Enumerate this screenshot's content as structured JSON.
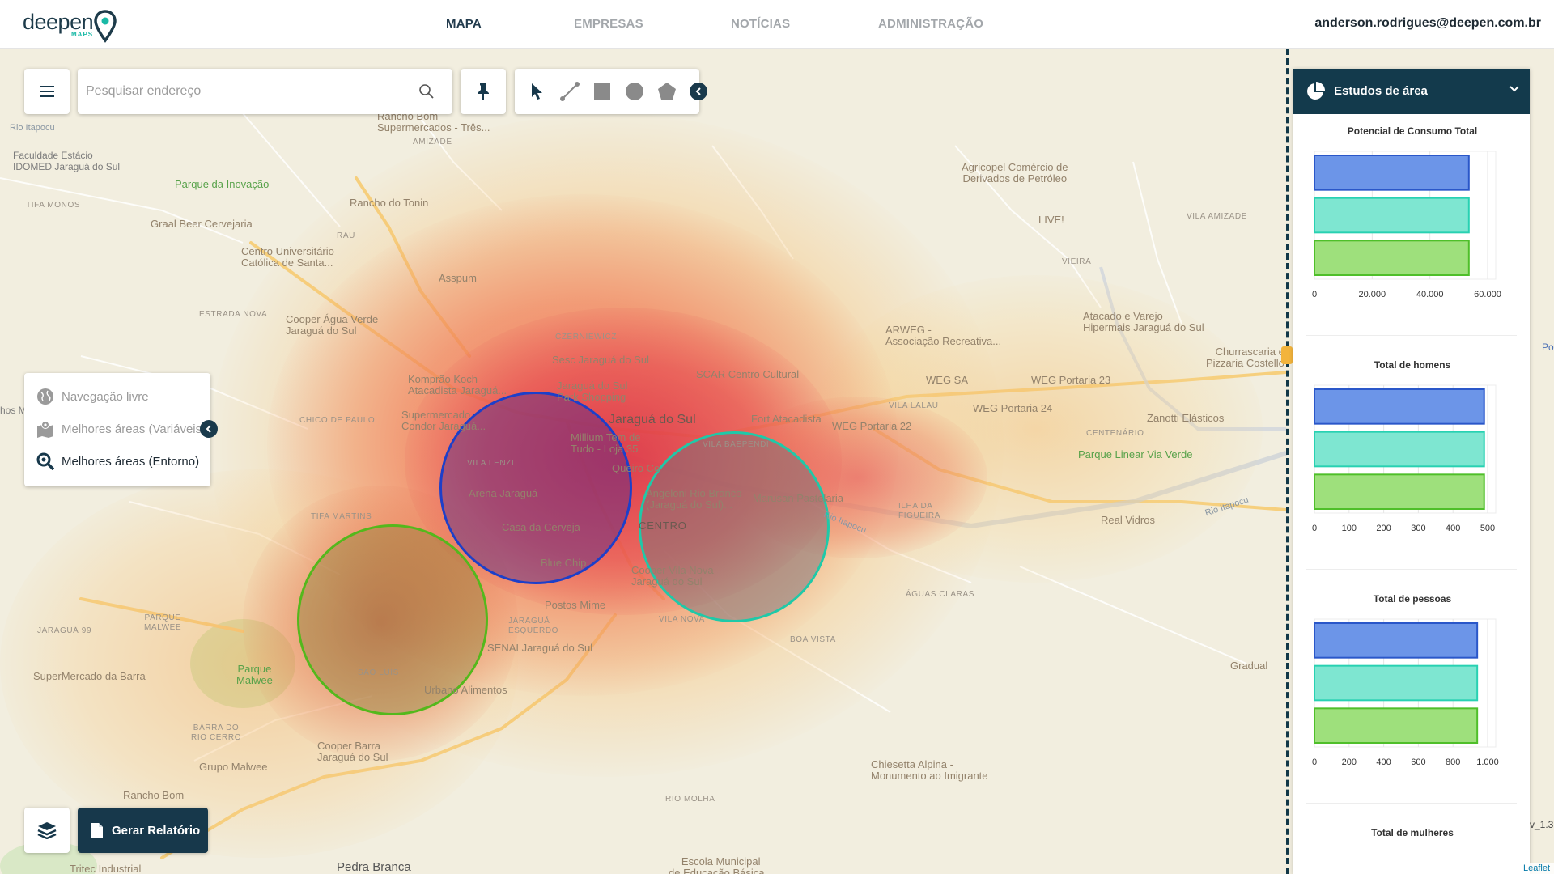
{
  "header": {
    "logo_text": "deepen",
    "logo_sub": "MAPS",
    "nav": [
      {
        "label": "MAPA",
        "active": true
      },
      {
        "label": "EMPRESAS",
        "active": false
      },
      {
        "label": "NOTÍCIAS",
        "active": false
      },
      {
        "label": "ADMINISTRAÇÃO",
        "active": false
      }
    ],
    "user_email": "anderson.rodrigues@deepen.com.br"
  },
  "search": {
    "placeholder": "Pesquisar endereço"
  },
  "tools": [
    "select-arrow-icon",
    "line-tool-icon",
    "rectangle-tool-icon",
    "circle-tool-icon",
    "polygon-tool-icon"
  ],
  "modes": [
    {
      "label": "Navegação livre",
      "active": false
    },
    {
      "label": "Melhores áreas (Variáveis)",
      "active": false
    },
    {
      "label": "Melhores áreas (Entorno)",
      "active": true
    }
  ],
  "report_button": "Gerar Relatório",
  "map_labels": {
    "rio_itapocu_nw": "Rio Itapocu",
    "faculdade": "Faculdade Estácio\nIDOMED Jaraguá do Sul",
    "tifa_monos": "TIFA MONOS",
    "parque_inovacao": "Parque da Inovação",
    "graal": "Graal Beer Cervejaria",
    "rancho_bom_super": "Rancho Bom\nSupermercados - Três...",
    "amizade": "AMIZADE",
    "rancho_tonin": "Rancho do Tonin",
    "rau": "RAU",
    "centro_univ": "Centro Universitário\nCatólica de Santa...",
    "asspum": "Asspum",
    "estrada_nova": "ESTRADA NOVA",
    "cooper_agua": "Cooper Água Verde\nJaraguá do Sul",
    "czerniewicz": "CZERNIEWICZ",
    "sesc": "Sesc Jaraguá do Sul",
    "komprao": "Komprão Koch\nAtacadista Jaraguá...",
    "scar": "SCAR Centro Cultural",
    "jaragua_park": "Jaraguá do Sul\nPark Shopping",
    "super_condor": "Supermercado\nCondor Jaraguá...",
    "chico_paulo": "CHICO DE PAULO",
    "jaragua_do_sul": "Jaraguá do Sul",
    "fort": "Fort Atacadista",
    "millium": "Millium Tem de\nTudo - Loja 35",
    "vila_lenzi": "VILA LENZI",
    "arena": "Arena Jaraguá",
    "queiro": "Queiro Co",
    "vila_baependi": "VILA BAEPENDI",
    "angeloni": "Angeloni Rio Branco\n(Jaraguá do Sul)...",
    "marusan": "Marusan Pastelaria",
    "casa_cerveja": "Casa da Cerveja",
    "centro": "CENTRO",
    "tifa_martins": "TIFA MARTINS",
    "blue_chip": "Blue Chip",
    "cooper_vila_nova": "Cooper Vila Nova\nJaraguá do Sul",
    "postos_mime": "Postos Mime",
    "jaragua_esquerdo": "JARAGUÁ\nESQUERDO",
    "vila_nova": "VILA NOVA",
    "senai": "SENAI Jaraguá do Sul",
    "boa_vista": "BOA VISTA",
    "sao_luis": "SÃO LUÍS",
    "urbano": "Urbano Alimentos",
    "jaragua_99": "JARAGUÁ 99",
    "parque_malwee_area": "PARQUE\nMALWEE",
    "parque_malwee": "Parque\nMalwee",
    "supermercado_barra": "SuperMercado da Barra",
    "barra_rio_cerro": "BARRA DO\nRIO CERRO",
    "cooper_barra": "Cooper Barra\nJaraguá do Sul",
    "grupo_malwee": "Grupo Malwee",
    "rancho_bom": "Rancho Bom",
    "tritec": "Tritec Industrial",
    "pedra_branca": "Pedra Branca",
    "escola": "Escola Municipal\nde Educação Básica...",
    "rio_molha": "RIO MOLHA",
    "chiesetta": "Chiesetta Alpina -\nMonumento ao Imigrante",
    "agricopel": "Agricopel Comércio de\nDerivados de Petróleo",
    "live": "LIVE!",
    "vila_amizade": "VILA AMIZADE",
    "vieira": "VIEIRA",
    "atacado_varejo": "Atacado e Varejo\nHipermais Jaraguá do Sul",
    "arweg": "ARWEG -\nAssociação Recreativa...",
    "churrascaria": "Churrascaria e\nPizzaria Costello",
    "weg_sa": "WEG SA",
    "weg_portaria_23": "WEG Portaria 23",
    "vila_lalau": "VILA LALAU",
    "weg_portaria_24": "WEG Portaria 24",
    "weg_portaria_22": "WEG Portaria 22",
    "zanotti": "Zanotti Elásticos",
    "centenario": "CENTENÁRIO",
    "parque_linear": "Parque Linear Via Verde",
    "rio_itapocu_e": "Rio Itapocu",
    "rio_itapocu_c": "Rio Itapocu",
    "ilha_figueira": "ILHA DA\nFIGUEIRA",
    "real_vidros": "Real Vidros",
    "aguas_claras": "ÁGUAS CLARAS",
    "gradual": "Gradual",
    "hospital_edge": "hos M",
    "po_edge": "Po",
    "v13_edge": "v_1.3"
  },
  "right_panel": {
    "title": "Estudos de área",
    "colors": {
      "blue": "#6c95e8",
      "teal": "#7ee6d1",
      "green": "#9ee07c"
    },
    "charts": [
      {
        "title": "Potencial de Consumo Total",
        "ticks": [
          "0",
          "20.000",
          "40.000",
          "60.000"
        ],
        "max": 60000,
        "values": [
          53500,
          53500,
          53500
        ]
      },
      {
        "title": "Total de homens",
        "ticks": [
          "0",
          "100",
          "200",
          "300",
          "400",
          "500"
        ],
        "max": 500,
        "values": [
          490,
          490,
          490
        ]
      },
      {
        "title": "Total de pessoas",
        "ticks": [
          "0",
          "200",
          "400",
          "600",
          "800",
          "1.000"
        ],
        "max": 1000,
        "values": [
          940,
          940,
          940
        ]
      },
      {
        "title": "Total de mulheres",
        "ticks": [],
        "max": 500,
        "values": []
      }
    ]
  },
  "attribution": "Leaflet"
}
